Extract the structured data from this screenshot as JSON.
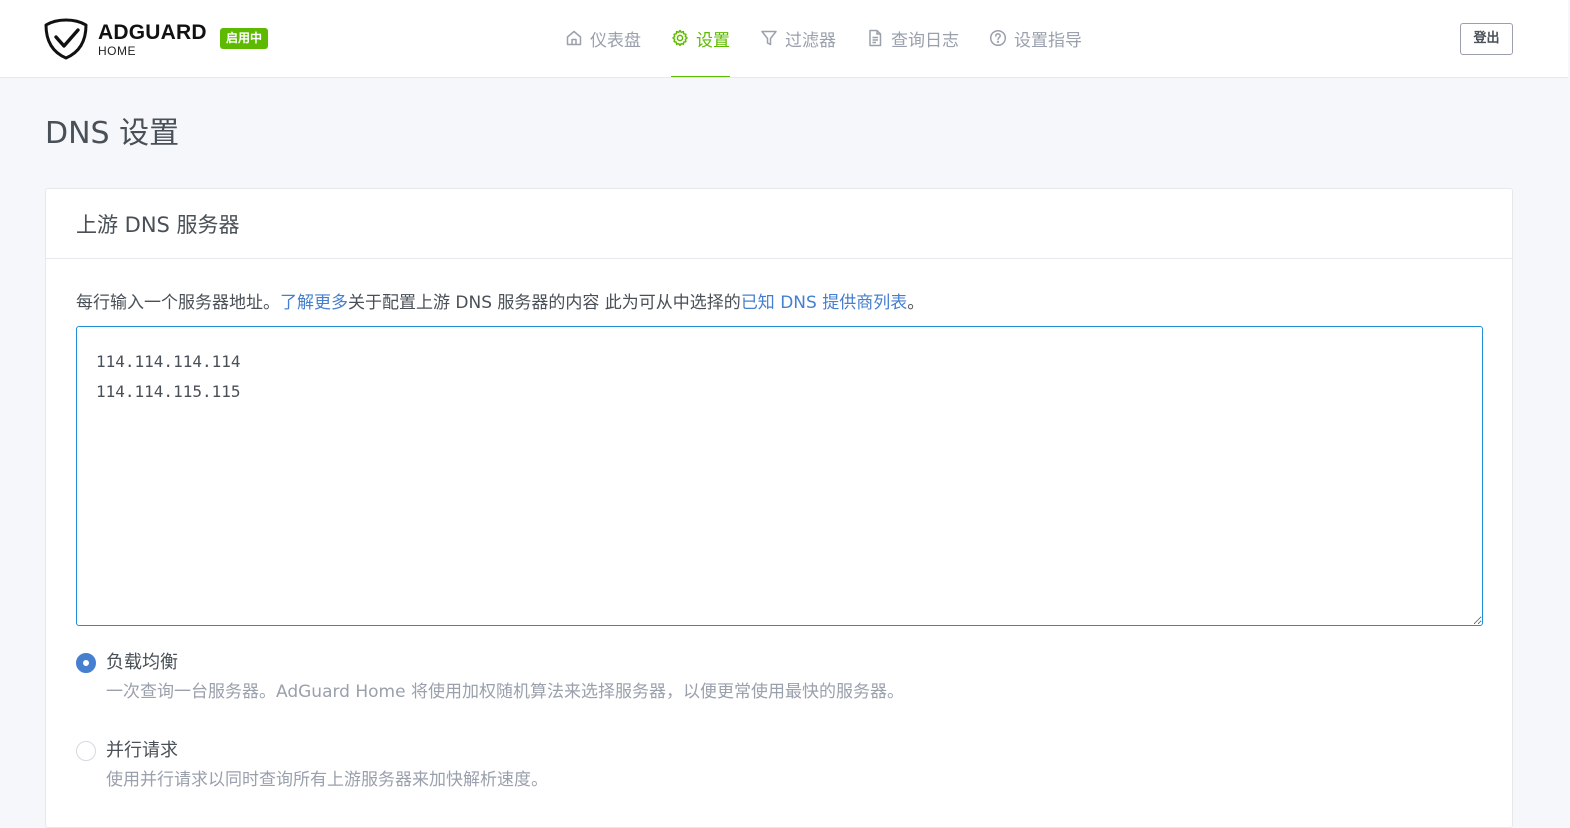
{
  "brand": {
    "name": "ADGUARD",
    "sub": "HOME",
    "status_badge": "启用中",
    "logo_icon": "shield-check-icon"
  },
  "nav": {
    "items": [
      {
        "label": "仪表盘",
        "icon": "home-icon"
      },
      {
        "label": "设置",
        "icon": "gear-icon",
        "active": true
      },
      {
        "label": "过滤器",
        "icon": "filter-icon"
      },
      {
        "label": "查询日志",
        "icon": "document-icon"
      },
      {
        "label": "设置指导",
        "icon": "help-circle-icon"
      }
    ],
    "logout_label": "登出"
  },
  "page": {
    "title": "DNS 设置"
  },
  "upstream": {
    "card_title": "上游 DNS 服务器",
    "help_prefix": "每行输入一个服务器地址。",
    "help_link1": "了解更多",
    "help_middle": "关于配置上游 DNS 服务器的内容 此为可从中选择的",
    "help_link2": "已知 DNS 提供商列表",
    "help_suffix": "。",
    "servers_text": "114.114.114.114\n114.114.115.115",
    "modes": [
      {
        "label": "负载均衡",
        "description": "一次查询一台服务器。AdGuard Home 将使用加权随机算法来选择服务器，以便更常使用最快的服务器。",
        "checked": true
      },
      {
        "label": "并行请求",
        "description": "使用并行请求以同时查询所有上游服务器来加快解析速度。",
        "checked": false
      }
    ]
  },
  "colors": {
    "accent_green": "#5eba00",
    "link_blue": "#467fcf",
    "textarea_focus": "#1f8fd8"
  }
}
